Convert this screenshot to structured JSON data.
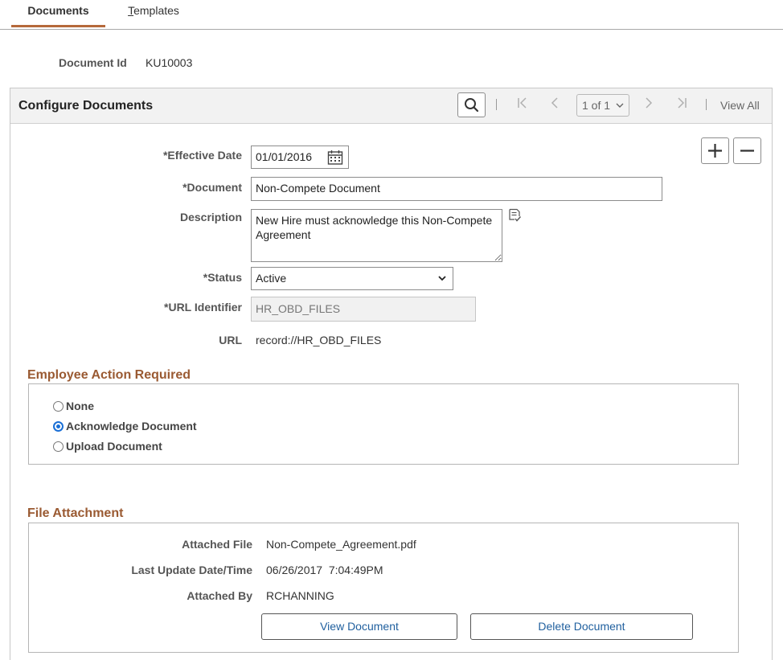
{
  "tabs": {
    "documents": "Documents",
    "templates_first": "T",
    "templates_rest": "emplates"
  },
  "header": {
    "document_id_label": "Document Id",
    "document_id_value": "KU10003"
  },
  "panel": {
    "title": "Configure Documents",
    "page_indicator": "1 of 1",
    "view_all": "View All"
  },
  "form": {
    "effective_date_label": "*Effective Date",
    "effective_date_value": "01/01/2016",
    "document_label": "*Document",
    "document_value": "Non-Compete Document",
    "description_label": "Description",
    "description_value": "New Hire must acknowledge this Non-Compete Agreement",
    "status_label": "*Status",
    "status_value": "Active",
    "url_identifier_label": "*URL Identifier",
    "url_identifier_value": "HR_OBD_FILES",
    "url_label": "URL",
    "url_value": "record://HR_OBD_FILES"
  },
  "employee_action": {
    "title": "Employee Action Required",
    "options": [
      {
        "label": "None",
        "checked": false
      },
      {
        "label": "Acknowledge Document",
        "checked": true
      },
      {
        "label": "Upload Document",
        "checked": false
      }
    ]
  },
  "file_attachment": {
    "title": "File Attachment",
    "attached_file_label": "Attached File",
    "attached_file_value": "Non-Compete_Agreement.pdf",
    "last_update_label": "Last Update Date/Time",
    "last_update_value": "06/26/2017  7:04:49PM",
    "attached_by_label": "Attached By",
    "attached_by_value": "RCHANNING",
    "view_button": "View Document",
    "delete_button": "Delete Document"
  },
  "icons": [
    "search-icon",
    "first-page-icon",
    "previous-page-icon",
    "next-page-icon",
    "last-page-icon",
    "calendar-icon",
    "spell-check-icon",
    "plus-icon",
    "minus-icon",
    "chevron-down-icon"
  ],
  "colors": {
    "tab_accent": "#b5693b",
    "section_title": "#9a5a32",
    "button_text": "#1f5f9e",
    "radio_checked": "#1a6fd6"
  }
}
